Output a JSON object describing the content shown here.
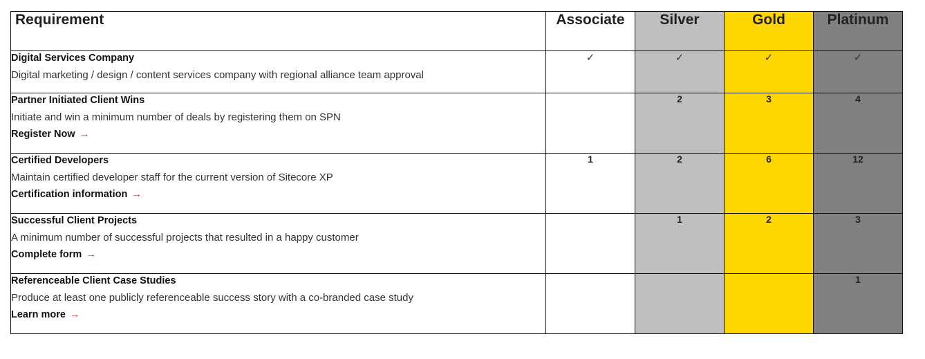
{
  "colors": {
    "associate": "#ffffff",
    "silver": "#bfbfbf",
    "gold": "#ffd700",
    "platinum": "#808080",
    "link_arrow": "#e0202a"
  },
  "header": {
    "requirement": "Requirement",
    "tiers": [
      "Associate",
      "Silver",
      "Gold",
      "Platinum"
    ]
  },
  "rows": [
    {
      "title": "Digital Services Company",
      "description": "Digital marketing / design / content services company with regional alliance team approval",
      "link": null,
      "values": [
        "✓",
        "✓",
        "✓",
        "✓"
      ]
    },
    {
      "title": "Partner Initiated Client Wins",
      "description": "Initiate and win a minimum number of deals by registering them on SPN",
      "link": "Register Now",
      "values": [
        "",
        "2",
        "3",
        "4"
      ]
    },
    {
      "title": "Certified Developers",
      "description": "Maintain certified developer staff for the current version of Sitecore XP",
      "link": "Certification information",
      "values": [
        "1",
        "2",
        "6",
        "12"
      ]
    },
    {
      "title": "Successful Client Projects",
      "description": "A minimum number of successful projects that resulted in a happy customer",
      "link": "Complete form",
      "values": [
        "",
        "1",
        "2",
        "3"
      ]
    },
    {
      "title": "Referenceable Client Case Studies",
      "description": "Produce at least one publicly referenceable success story with a co-branded case study",
      "link": "Learn more",
      "values": [
        "",
        "",
        "",
        "1"
      ]
    }
  ],
  "icons": {
    "arrow": "→",
    "check": "✓"
  }
}
